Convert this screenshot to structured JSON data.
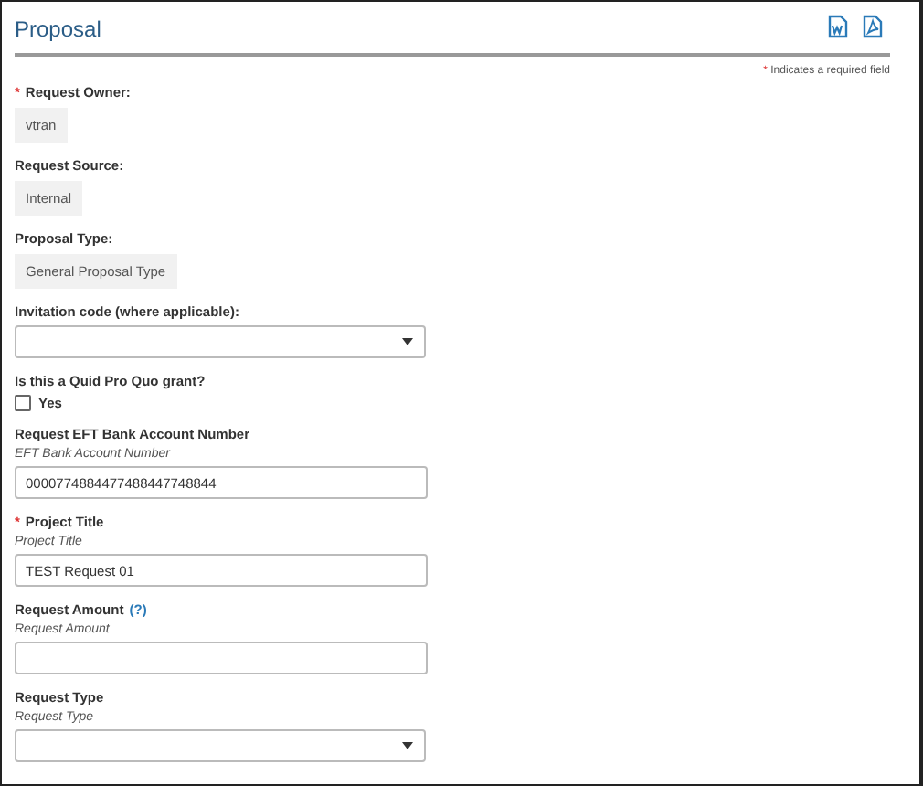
{
  "header": {
    "title": "Proposal"
  },
  "required_note": {
    "mark": "*",
    "text": "Indicates a required field"
  },
  "fields": [
    {
      "kind": "readonly",
      "label": "Request Owner:",
      "required": true,
      "value": "vtran"
    },
    {
      "kind": "readonly",
      "label": "Request Source:",
      "required": false,
      "value": "Internal"
    },
    {
      "kind": "readonly",
      "label": "Proposal Type:",
      "required": false,
      "value": "General Proposal Type"
    },
    {
      "kind": "select",
      "label": "Invitation code (where applicable):",
      "required": false
    },
    {
      "kind": "checkbox",
      "label": "Is this a Quid Pro Quo grant?",
      "required": false,
      "option": "Yes",
      "checked": false
    },
    {
      "kind": "text",
      "label": "Request EFT Bank Account Number",
      "required": false,
      "hint": "EFT Bank Account Number",
      "value": "0000774884477488447748844"
    },
    {
      "kind": "text",
      "label": "Project Title",
      "required": true,
      "hint": "Project Title",
      "value": "TEST Request 01"
    },
    {
      "kind": "text",
      "label": "Request Amount",
      "required": false,
      "help": "(?)",
      "hint": "Request Amount"
    },
    {
      "kind": "select",
      "label": "Request Type",
      "required": false,
      "hint": "Request Type"
    }
  ]
}
